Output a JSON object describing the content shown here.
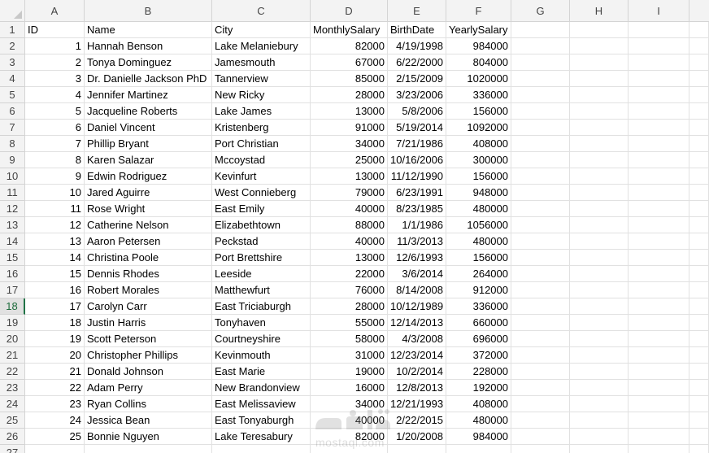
{
  "columns": [
    "A",
    "B",
    "C",
    "D",
    "E",
    "F",
    "G",
    "H",
    "I"
  ],
  "active_row": 18,
  "header_row": {
    "row_num": "1",
    "cells": [
      "ID",
      "Name",
      "City",
      "MonthlySalary",
      "BirthDate",
      "YearlySalary",
      "",
      "",
      ""
    ]
  },
  "rows": [
    {
      "row_num": "2",
      "id": "1",
      "name": "Hannah Benson",
      "city": "Lake Melaniebury",
      "monthly": "82000",
      "birth": "4/19/1998",
      "yearly": "984000"
    },
    {
      "row_num": "3",
      "id": "2",
      "name": "Tonya Dominguez",
      "city": "Jamesmouth",
      "monthly": "67000",
      "birth": "6/22/2000",
      "yearly": "804000"
    },
    {
      "row_num": "4",
      "id": "3",
      "name": "Dr. Danielle Jackson PhD",
      "city": "Tannerview",
      "monthly": "85000",
      "birth": "2/15/2009",
      "yearly": "1020000"
    },
    {
      "row_num": "5",
      "id": "4",
      "name": "Jennifer Martinez",
      "city": "New Ricky",
      "monthly": "28000",
      "birth": "3/23/2006",
      "yearly": "336000"
    },
    {
      "row_num": "6",
      "id": "5",
      "name": "Jacqueline Roberts",
      "city": "Lake James",
      "monthly": "13000",
      "birth": "5/8/2006",
      "yearly": "156000"
    },
    {
      "row_num": "7",
      "id": "6",
      "name": "Daniel Vincent",
      "city": "Kristenberg",
      "monthly": "91000",
      "birth": "5/19/2014",
      "yearly": "1092000"
    },
    {
      "row_num": "8",
      "id": "7",
      "name": "Phillip Bryant",
      "city": "Port Christian",
      "monthly": "34000",
      "birth": "7/21/1986",
      "yearly": "408000"
    },
    {
      "row_num": "9",
      "id": "8",
      "name": "Karen Salazar",
      "city": "Mccoystad",
      "monthly": "25000",
      "birth": "10/16/2006",
      "yearly": "300000"
    },
    {
      "row_num": "10",
      "id": "9",
      "name": "Edwin Rodriguez",
      "city": "Kevinfurt",
      "monthly": "13000",
      "birth": "11/12/1990",
      "yearly": "156000"
    },
    {
      "row_num": "11",
      "id": "10",
      "name": "Jared Aguirre",
      "city": "West Connieberg",
      "monthly": "79000",
      "birth": "6/23/1991",
      "yearly": "948000"
    },
    {
      "row_num": "12",
      "id": "11",
      "name": "Rose Wright",
      "city": "East Emily",
      "monthly": "40000",
      "birth": "8/23/1985",
      "yearly": "480000"
    },
    {
      "row_num": "13",
      "id": "12",
      "name": "Catherine Nelson",
      "city": "Elizabethtown",
      "monthly": "88000",
      "birth": "1/1/1986",
      "yearly": "1056000"
    },
    {
      "row_num": "14",
      "id": "13",
      "name": "Aaron Petersen",
      "city": "Peckstad",
      "monthly": "40000",
      "birth": "11/3/2013",
      "yearly": "480000"
    },
    {
      "row_num": "15",
      "id": "14",
      "name": "Christina Poole",
      "city": "Port Brettshire",
      "monthly": "13000",
      "birth": "12/6/1993",
      "yearly": "156000"
    },
    {
      "row_num": "16",
      "id": "15",
      "name": "Dennis Rhodes",
      "city": "Leeside",
      "monthly": "22000",
      "birth": "3/6/2014",
      "yearly": "264000"
    },
    {
      "row_num": "17",
      "id": "16",
      "name": "Robert Morales",
      "city": "Matthewfurt",
      "monthly": "76000",
      "birth": "8/14/2008",
      "yearly": "912000"
    },
    {
      "row_num": "18",
      "id": "17",
      "name": "Carolyn Carr",
      "city": "East Triciaburgh",
      "monthly": "28000",
      "birth": "10/12/1989",
      "yearly": "336000"
    },
    {
      "row_num": "19",
      "id": "18",
      "name": "Justin Harris",
      "city": "Tonyhaven",
      "monthly": "55000",
      "birth": "12/14/2013",
      "yearly": "660000"
    },
    {
      "row_num": "20",
      "id": "19",
      "name": "Scott Peterson",
      "city": "Courtneyshire",
      "monthly": "58000",
      "birth": "4/3/2008",
      "yearly": "696000"
    },
    {
      "row_num": "21",
      "id": "20",
      "name": "Christopher Phillips",
      "city": "Kevinmouth",
      "monthly": "31000",
      "birth": "12/23/2014",
      "yearly": "372000"
    },
    {
      "row_num": "22",
      "id": "21",
      "name": "Donald Johnson",
      "city": "East Marie",
      "monthly": "19000",
      "birth": "10/2/2014",
      "yearly": "228000"
    },
    {
      "row_num": "23",
      "id": "22",
      "name": "Adam Perry",
      "city": "New Brandonview",
      "monthly": "16000",
      "birth": "12/8/2013",
      "yearly": "192000"
    },
    {
      "row_num": "24",
      "id": "23",
      "name": "Ryan Collins",
      "city": "East Melissaview",
      "monthly": "34000",
      "birth": "12/21/1993",
      "yearly": "408000"
    },
    {
      "row_num": "25",
      "id": "24",
      "name": "Jessica Bean",
      "city": "East Tonyaburgh",
      "monthly": "40000",
      "birth": "2/22/2015",
      "yearly": "480000"
    },
    {
      "row_num": "26",
      "id": "25",
      "name": "Bonnie Nguyen",
      "city": "Lake Teresabury",
      "monthly": "82000",
      "birth": "1/20/2008",
      "yearly": "984000"
    }
  ],
  "next_row_num": "27",
  "watermark": {
    "icon": "mostaql-logo-icon",
    "text": "mostaql.com"
  }
}
